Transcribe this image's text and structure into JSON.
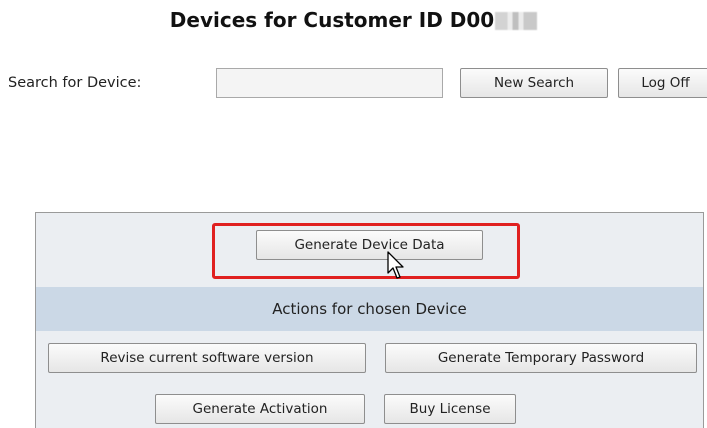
{
  "header": {
    "title": "Devices for Customer ID D00"
  },
  "search": {
    "label": "Search for Device:",
    "value": "",
    "placeholder": "",
    "new_search_label": "New Search",
    "log_off_label": "Log Off"
  },
  "actions_panel": {
    "generate_device_data_label": "Generate Device Data",
    "section_title": "Actions for chosen Device",
    "revise_software_label": "Revise current software version",
    "generate_temp_password_label": "Generate Temporary Password",
    "generate_activation_label": "Generate Activation",
    "buy_license_label": "Buy License"
  },
  "colors": {
    "highlight_border": "#e02020",
    "section_header_bg": "#cbd8e6",
    "panel_bg": "#ebeef2"
  },
  "icons": {
    "cursor": "mouse-pointer-icon"
  }
}
